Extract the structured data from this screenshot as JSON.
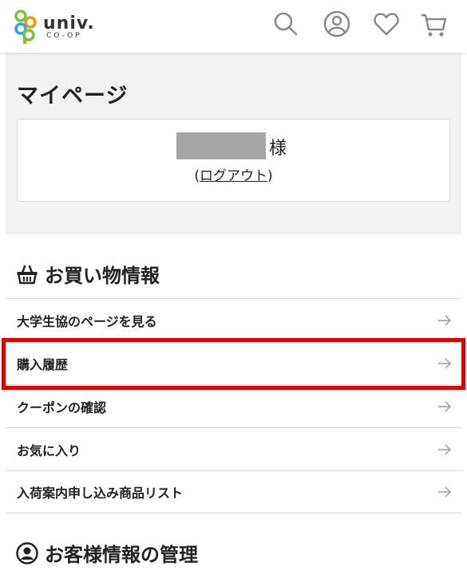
{
  "header": {
    "logo_text": "univ.",
    "logo_sub": "CO-OP",
    "icons": [
      "search-icon",
      "user-circle-icon",
      "heart-icon",
      "cart-icon"
    ]
  },
  "mypage": {
    "title": "マイページ",
    "honorific": "様",
    "logout_open": "(",
    "logout_label": "ログアウト",
    "logout_close": ")"
  },
  "shopping": {
    "title": "お買い物情報",
    "items": [
      {
        "label": "大学生協のページを見る"
      },
      {
        "label": "購入履歴"
      },
      {
        "label": "クーポンの確認"
      },
      {
        "label": "お気に入り"
      },
      {
        "label": "入荷案内申し込み商品リスト"
      }
    ]
  },
  "customer": {
    "title": "お客様情報の管理"
  },
  "colors": {
    "highlight": "#e00000",
    "panel_bg": "#f2f2f2",
    "logo_green": "#7cc242",
    "logo_blue": "#2aa7df",
    "logo_orange": "#f39800"
  }
}
